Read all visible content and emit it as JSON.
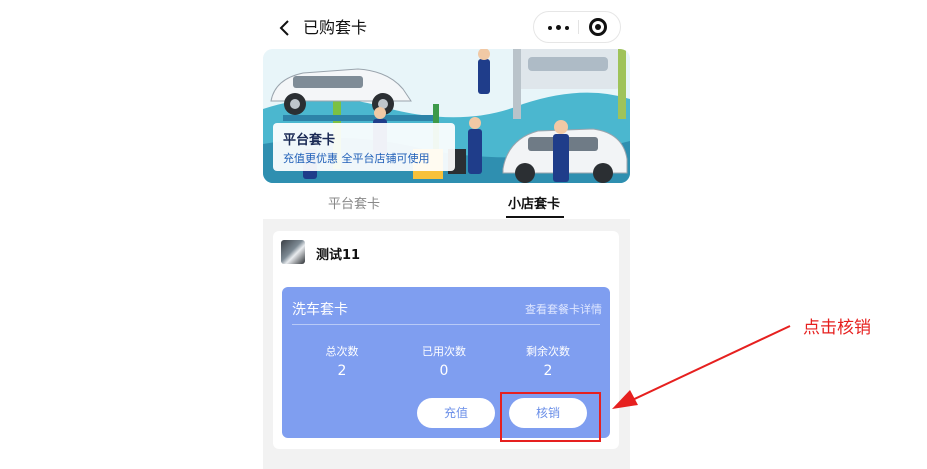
{
  "nav": {
    "title": "已购套卡",
    "icons": [
      "back-icon",
      "more-icon",
      "close-target-icon"
    ]
  },
  "banner": {
    "title": "平台套卡",
    "subtitle": "充值更优惠   全平台店铺可使用"
  },
  "tabs": [
    {
      "label": "平台套卡",
      "active": false
    },
    {
      "label": "小店套卡",
      "active": true
    }
  ],
  "shop": {
    "name": "测试11",
    "package": {
      "name": "洗车套卡",
      "detail_link": "查看套餐卡详情",
      "stats": [
        {
          "label": "总次数",
          "value": "2"
        },
        {
          "label": "已用次数",
          "value": "0"
        },
        {
          "label": "剩余次数",
          "value": "2"
        }
      ],
      "buttons": {
        "recharge": "充值",
        "verify": "核销"
      }
    }
  },
  "annotation": {
    "text": "点击核销",
    "color": "#e6201f"
  },
  "colors": {
    "package_card": "#7f9ef0",
    "button_text": "#6b8fe8"
  }
}
